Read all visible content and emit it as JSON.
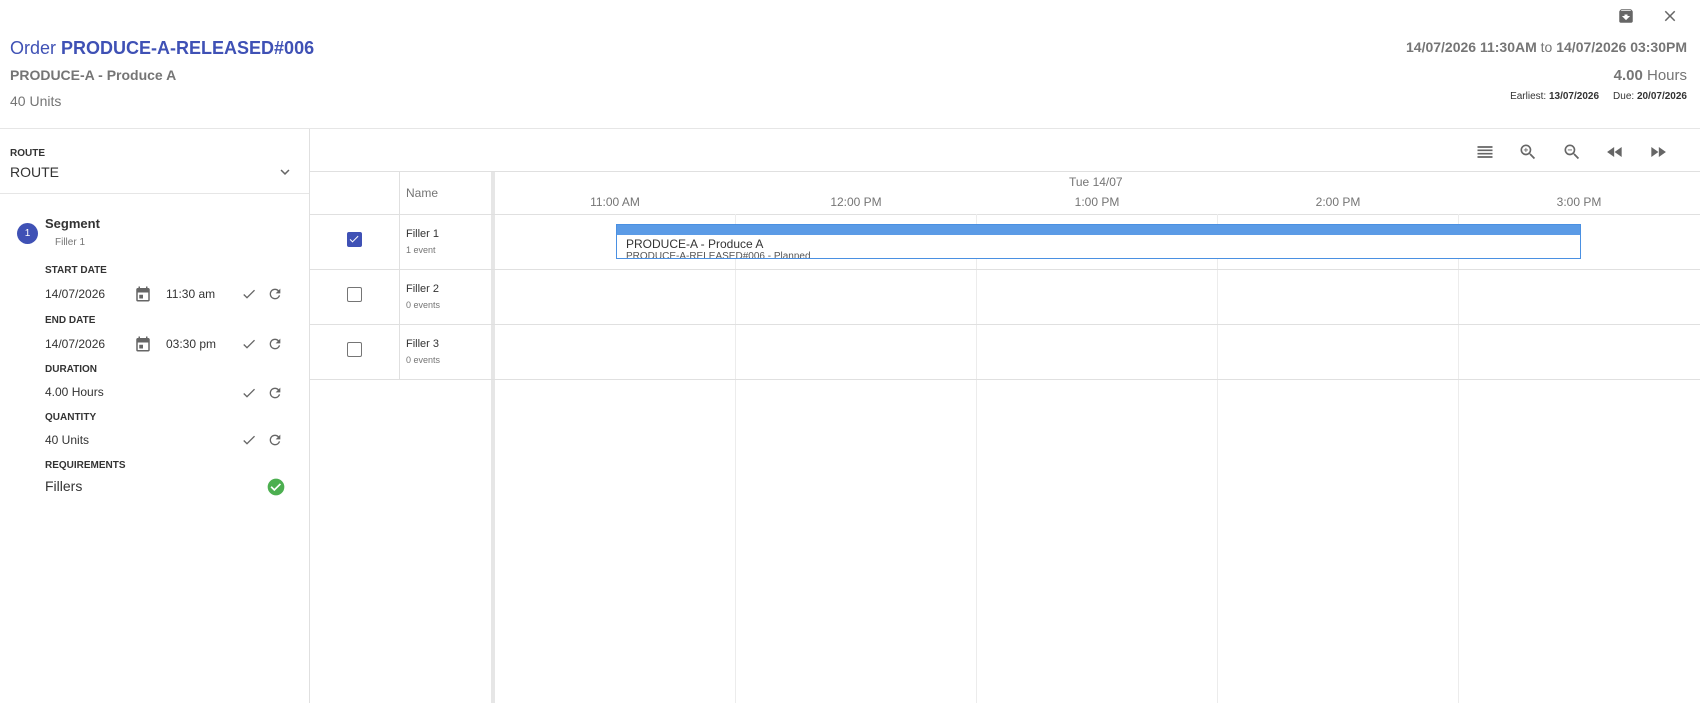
{
  "header": {
    "order_label": "Order",
    "order_id": "PRODUCE-A-RELEASED#006",
    "product": "PRODUCE-A - Produce A",
    "units": "40 Units",
    "range_start": "14/07/2026 11:30AM",
    "range_to": "to",
    "range_end": "14/07/2026 03:30PM",
    "hours_value": "4.00",
    "hours_unit": "Hours",
    "earliest_label": "Earliest:",
    "earliest_value": "13/07/2026",
    "due_label": "Due:",
    "due_value": "20/07/2026",
    "icons": [
      "archive-icon",
      "close-icon"
    ]
  },
  "route": {
    "label": "ROUTE",
    "value": "ROUTE"
  },
  "segment": {
    "number": "1",
    "title": "Segment",
    "subtitle": "Filler 1",
    "start_date_label": "START DATE",
    "start_date": "14/07/2026",
    "start_time": "11:30 am",
    "end_date_label": "END DATE",
    "end_date": "14/07/2026",
    "end_time": "03:30 pm",
    "duration_label": "DURATION",
    "duration": "4.00 Hours",
    "quantity_label": "QUANTITY",
    "quantity": "40 Units",
    "requirements_label": "REQUIREMENTS",
    "requirements": "Fillers"
  },
  "timeline": {
    "name_header": "Name",
    "day": "Tue 14/07",
    "ticks": [
      "11:00 AM",
      "12:00 PM",
      "1:00 PM",
      "2:00 PM",
      "3:00 PM"
    ],
    "toolbar_icons": [
      "list-icon",
      "zoom-in-icon",
      "zoom-out-icon",
      "rewind-icon",
      "fast-forward-icon"
    ],
    "rows": [
      {
        "name": "Filler 1",
        "events": "1 event",
        "checked": true
      },
      {
        "name": "Filler 2",
        "events": "0 events",
        "checked": false
      },
      {
        "name": "Filler 3",
        "events": "0 events",
        "checked": false
      }
    ],
    "event": {
      "title": "PRODUCE-A - Produce A",
      "subtitle": "PRODUCE-A-RELEASED#006 - Planned"
    }
  },
  "colors": {
    "accent": "#3f51b5",
    "event": "#5b9be6",
    "success": "#4caf50"
  }
}
